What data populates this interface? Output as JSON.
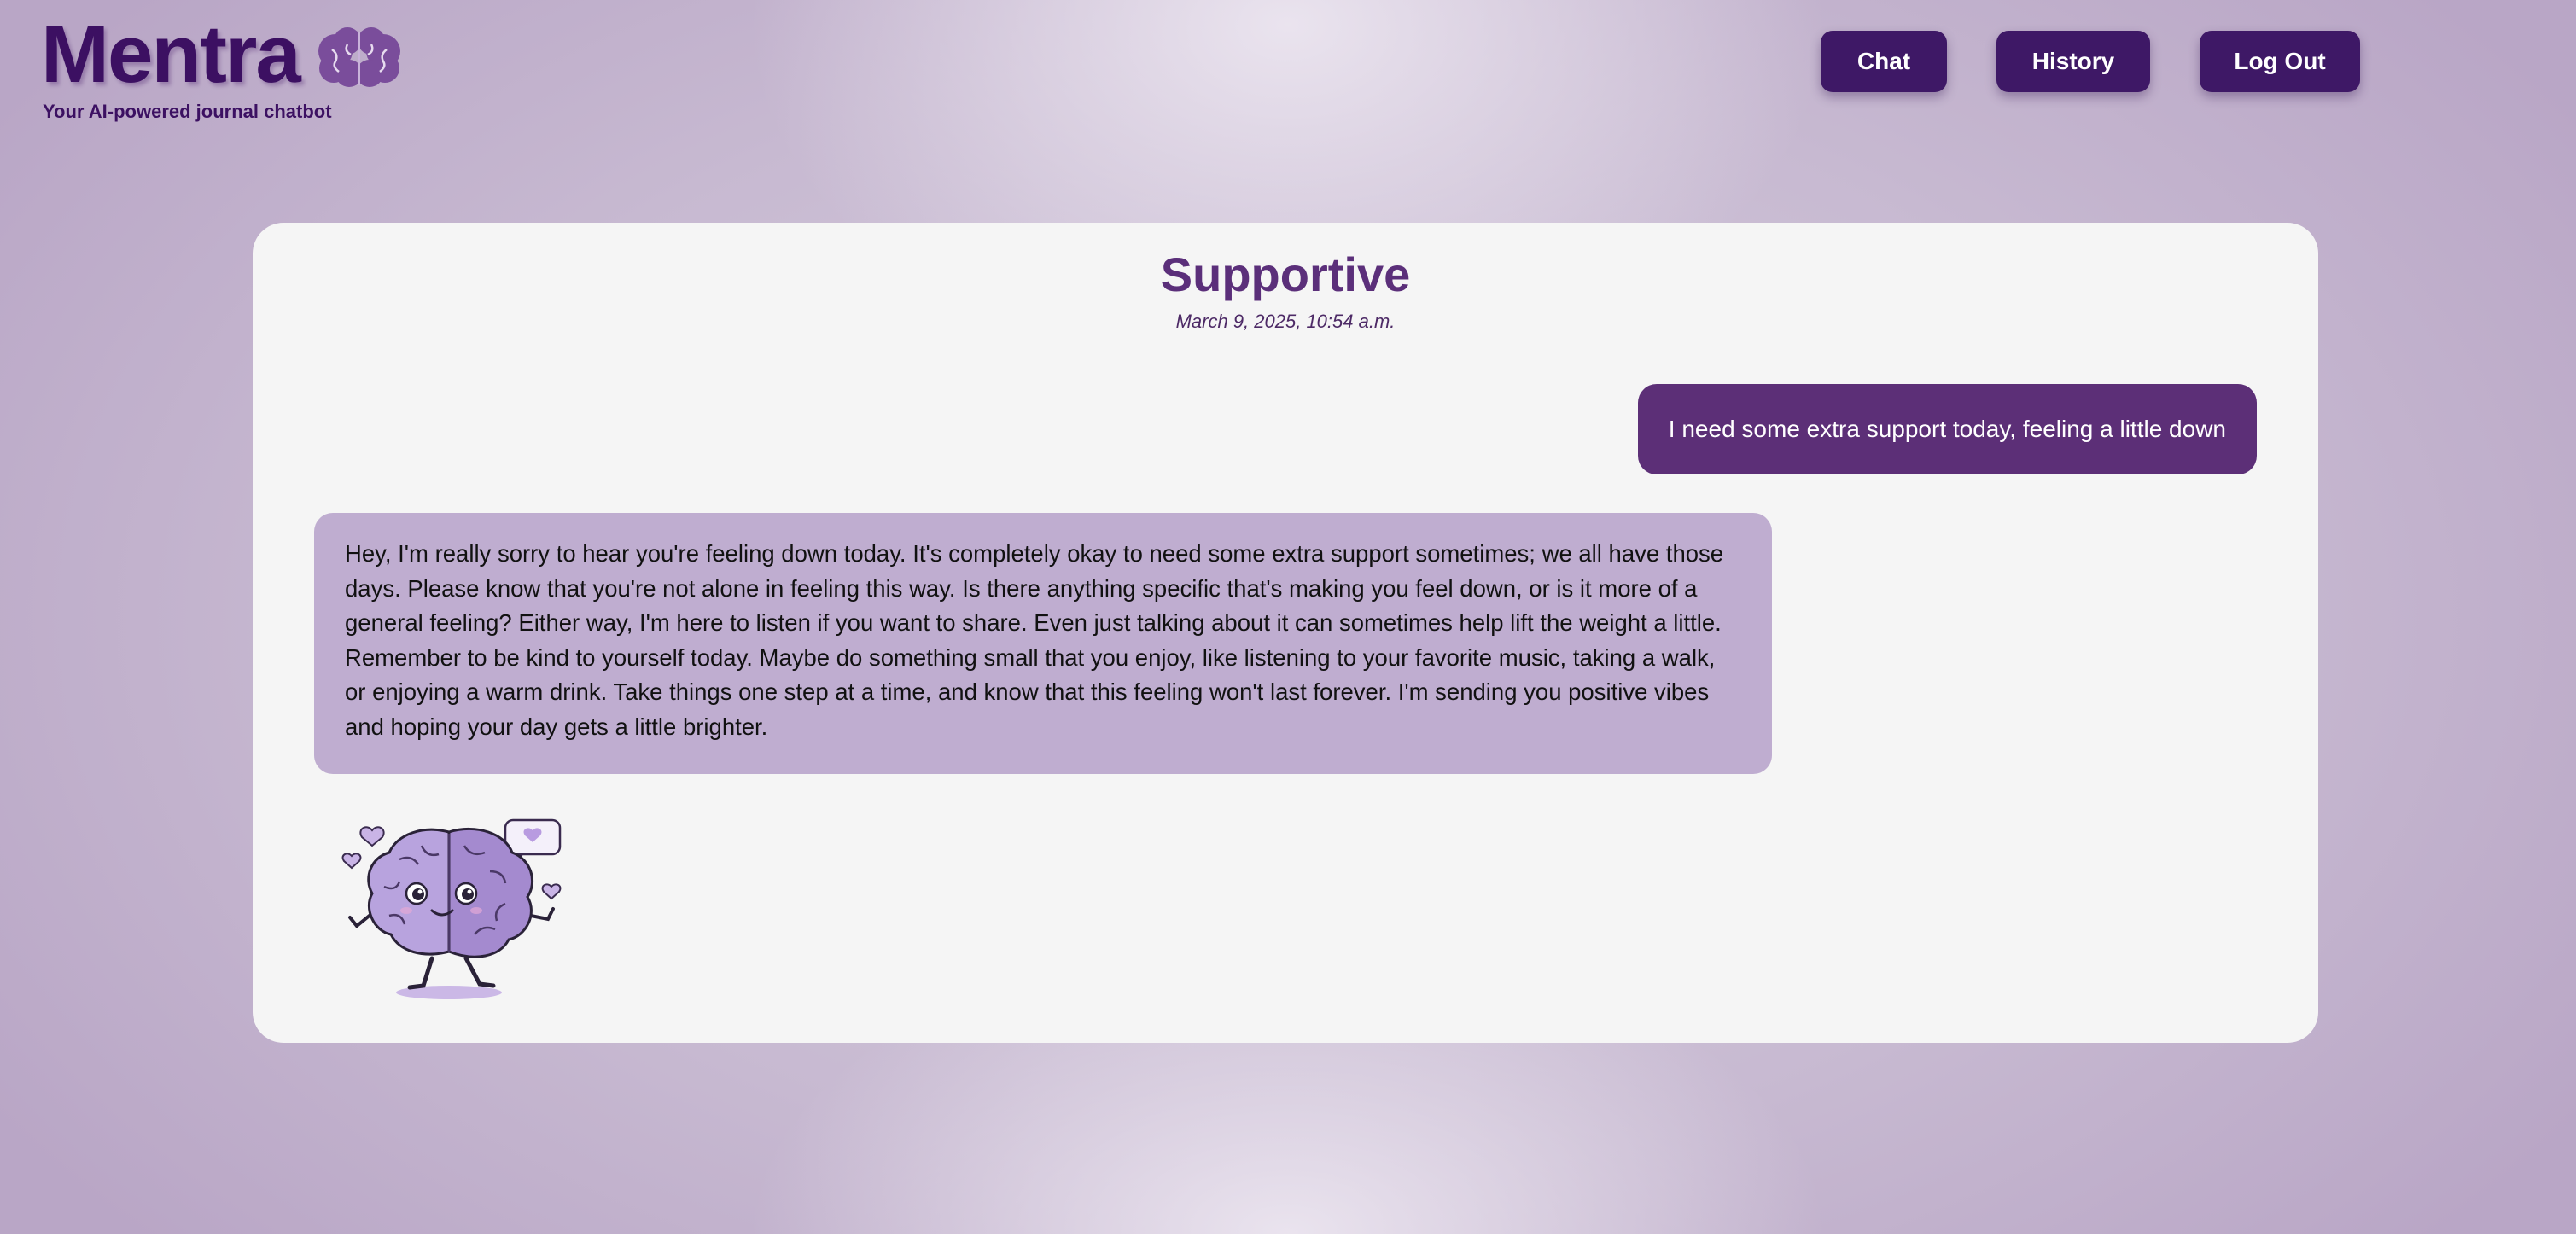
{
  "header": {
    "title": "Mentra",
    "tagline": "Your AI-powered journal chatbot",
    "logo_icon": "brain-icon",
    "nav": {
      "chat": "Chat",
      "history": "History",
      "logout": "Log Out"
    }
  },
  "conversation": {
    "mood": "Supportive",
    "date": "March 9, 2025, 10:54 a.m.",
    "user_message": "I need some extra support today, feeling a little down",
    "bot_message": "Hey, I'm really sorry to hear you're feeling down today. It's completely okay to need some extra support sometimes; we all have those days. Please know that you're not alone in feeling this way. Is there anything specific that's making you feel down, or is it more of a general feeling? Either way, I'm here to listen if you want to share. Even just talking about it can sometimes help lift the weight a little. Remember to be kind to yourself today. Maybe do something small that you enjoy, like listening to your favorite music, taking a walk, or enjoying a warm drink. Take things one step at a time, and know that this feeling won't last forever. I'm sending you positive vibes and hoping your day gets a little brighter.",
    "mascot_icon": "brain-mascot-icon"
  },
  "colors": {
    "brand": "#3c1062",
    "nav_button": "#3e1866",
    "title": "#5b2f7a",
    "user_bubble": "#5c2f77",
    "bot_bubble": "#bfadd0",
    "card": "#f5f5f5"
  }
}
